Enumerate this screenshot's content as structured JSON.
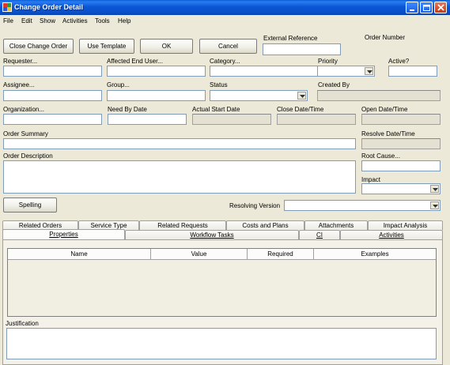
{
  "window": {
    "title": "Change Order Detail",
    "icon": "app-icon",
    "controls": [
      "minimize-icon",
      "maximize-icon",
      "close-icon"
    ],
    "accent_color": "#0a56d6",
    "close_color": "#c43b16"
  },
  "menu": [
    "File",
    "Edit",
    "Show",
    "Activities",
    "Tools",
    "Help"
  ],
  "toolbar": {
    "close_change_order": "Close Change Order",
    "use_template": "Use Template",
    "ok": "OK",
    "cancel": "Cancel"
  },
  "header": {
    "external_reference_label": "External Reference",
    "external_reference_value": "",
    "order_number_label": "Order Number",
    "order_number_value": ""
  },
  "row1": {
    "requester": "Requester...",
    "affected_end_user": "Affected End User...",
    "category": "Category...",
    "priority": "Priority",
    "active": "Active?"
  },
  "row2": {
    "assignee": "Assignee...",
    "group": "Group...",
    "status": "Status",
    "created_by": "Created By"
  },
  "row3": {
    "organization": "Organization...",
    "need_by_date": "Need By Date",
    "actual_start_date": "Actual Start Date",
    "close_date_time": "Close Date/Time",
    "open_date_time": "Open Date/Time"
  },
  "summary": {
    "order_summary": "Order Summary",
    "resolve_date_time": "Resolve Date/Time",
    "order_description": "Order Description",
    "root_cause": "Root Cause...",
    "impact": "Impact"
  },
  "spelling_button": "Spelling",
  "resolving_version": "Resolving Version",
  "tabs_row1": [
    "Related Orders",
    "Service Type",
    "Related Requests",
    "Costs and Plans",
    "Attachments",
    "Impact Analysis"
  ],
  "tabs_row2": [
    "Properties",
    "Workflow Tasks",
    "CI",
    "Activities"
  ],
  "active_tab": "Properties",
  "grid_columns": [
    "Name",
    "Value",
    "Required",
    "Examples"
  ],
  "justification": "Justification"
}
